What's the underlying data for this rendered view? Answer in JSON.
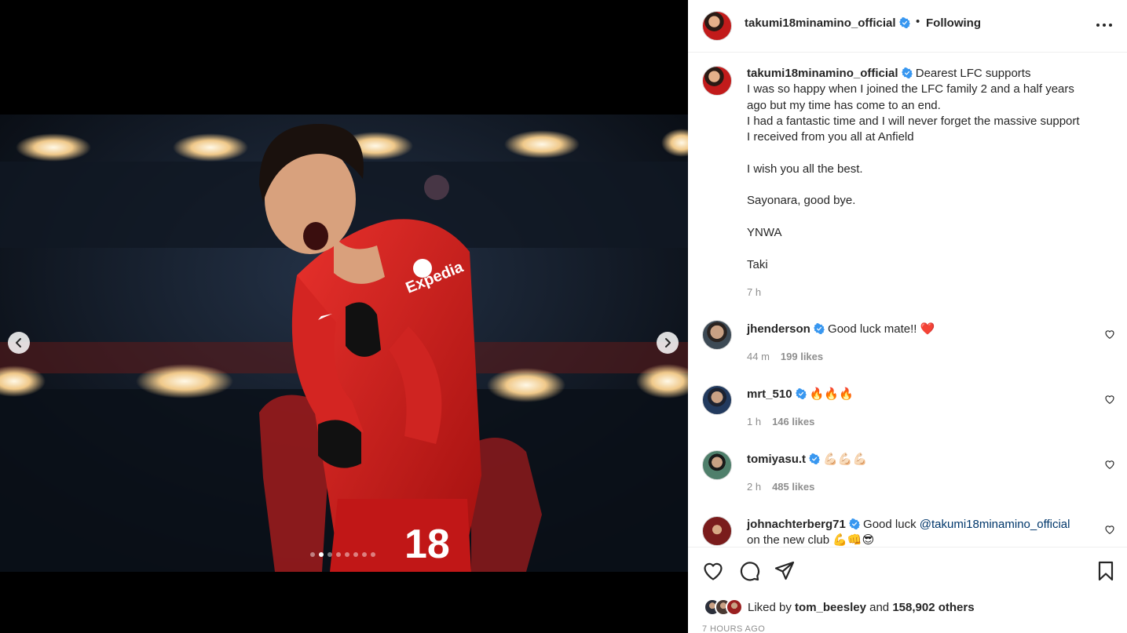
{
  "post": {
    "username": "takumi18minamino_official",
    "follow_status": "Following",
    "separator": "•",
    "carousel": {
      "total": 8,
      "active_index": 1
    }
  },
  "caption": {
    "username": "takumi18minamino_official",
    "first_line": "Dearest LFC supports",
    "lines": [
      "I was so happy when I joined the LFC family 2 and a half years",
      "ago but my time has come to an end.",
      "I had a fantastic time and I will never forget the massive support",
      "I received from you all at Anfield",
      "",
      "I wish you all the best.",
      "",
      "Sayonara, good bye.",
      "",
      "YNWA",
      "",
      "Taki"
    ],
    "time": "7 h"
  },
  "comments": [
    {
      "username": "jhenderson",
      "text": "Good luck mate!! ❤️",
      "time": "44 m",
      "likes": "199 likes"
    },
    {
      "username": "mrt_510",
      "text": "🔥🔥🔥",
      "time": "1 h",
      "likes": "146 likes"
    },
    {
      "username": "tomiyasu.t",
      "text": "💪🏻💪🏻💪🏻",
      "time": "2 h",
      "likes": "485 likes"
    },
    {
      "username": "johnachterberg71",
      "text_before": "Good luck ",
      "mention": "@takumi18minamino_official",
      "text_after": "on the new club 💪👊😎"
    }
  ],
  "likes": {
    "prefix": "Liked by ",
    "user": "tom_beesley",
    "middle": " and ",
    "count": "158,902 others"
  },
  "timestamp": "7 HOURS AGO",
  "colors": {
    "verified": "#3897f0",
    "link": "#00376b",
    "muted": "#8e8e8e",
    "heart": "#ed4956"
  }
}
